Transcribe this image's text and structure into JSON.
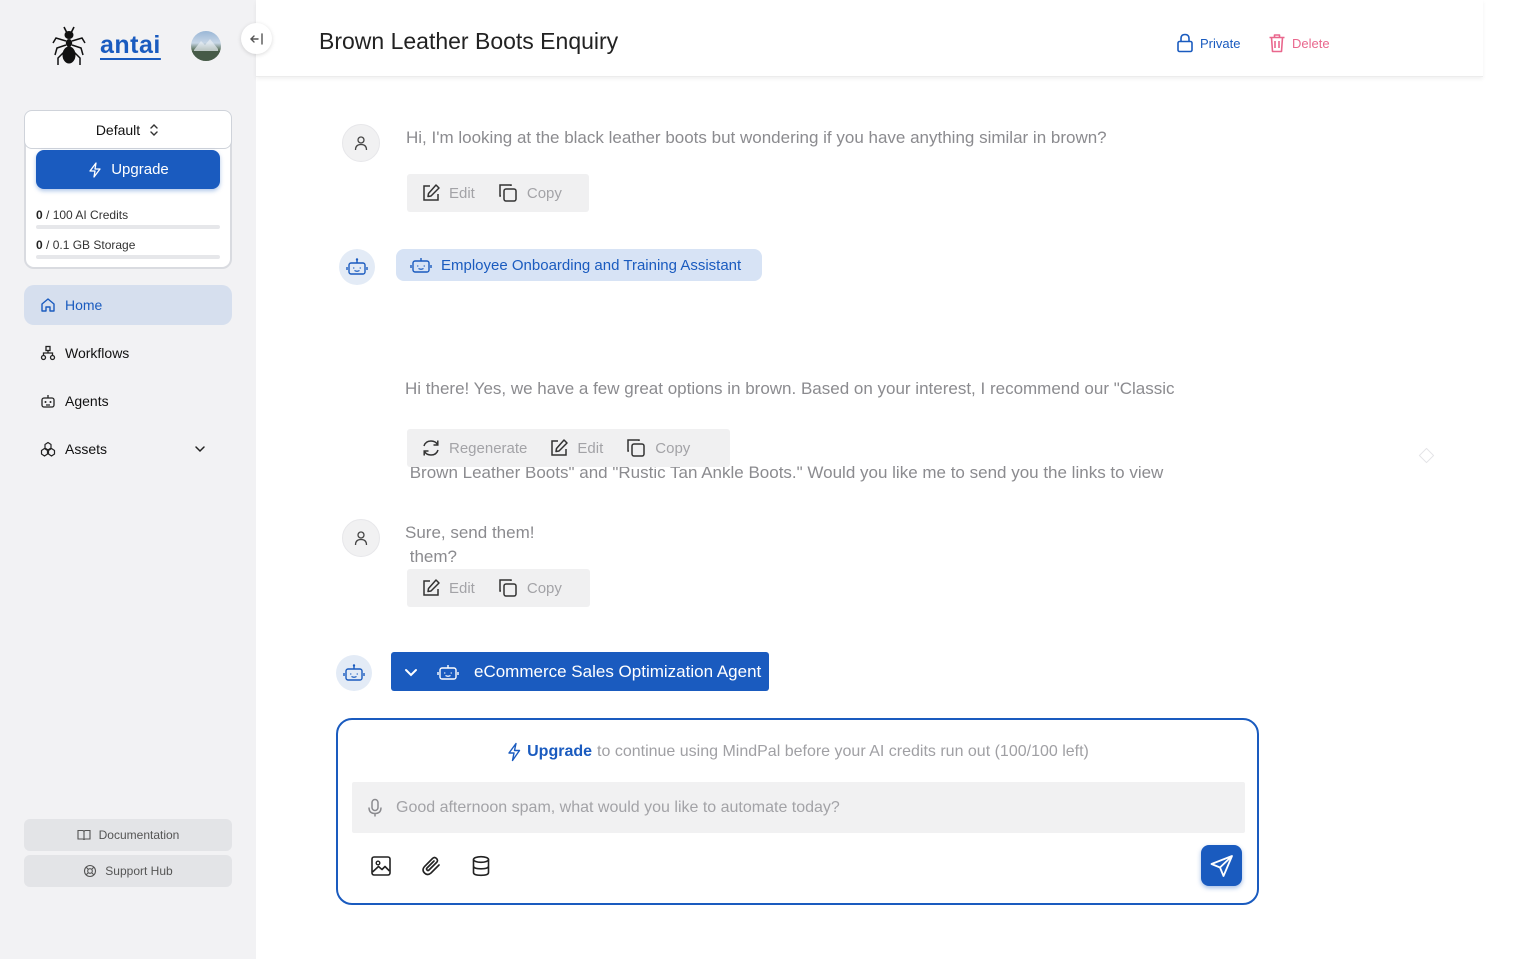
{
  "sidebar": {
    "brand": "antai",
    "workspace": {
      "label": "Default"
    },
    "upgrade_label": "Upgrade",
    "quotas": [
      {
        "used": "0",
        "rest": " / 100 AI Credits",
        "fraction": 0
      },
      {
        "used": "0",
        "rest": " / 0.1 GB Storage",
        "fraction": 0
      }
    ],
    "nav": [
      {
        "label": "Home",
        "icon": "home-icon",
        "active": true
      },
      {
        "label": "Workflows",
        "icon": "workflow-icon"
      },
      {
        "label": "Agents",
        "icon": "robot-icon"
      },
      {
        "label": "Assets",
        "icon": "assets-icon"
      }
    ],
    "footer": {
      "documentation": "Documentation",
      "support": "Support Hub"
    }
  },
  "header": {
    "title": "Brown Leather Boots Enquiry",
    "private_label": "Private",
    "delete_label": "Delete"
  },
  "chat": {
    "messages": [
      {
        "role": "user",
        "text": "Hi, I'm looking at the black leather boots but wondering if you have anything similar in brown?",
        "actions": [
          "Edit",
          "Copy"
        ]
      },
      {
        "role": "agent",
        "agent_name": "Employee Onboarding and Training Assistant",
        "lines": [
          "Hi there! Yes, we have a few great options in brown. Based on your interest, I recommend our \"Classic",
          " Brown Leather Boots\" and \"Rustic Tan Ankle Boots.\" Would you like me to send you the links to view",
          " them?"
        ],
        "actions": [
          "Regenerate",
          "Edit",
          "Copy"
        ]
      },
      {
        "role": "user",
        "text": "Sure, send them!",
        "actions": [
          "Edit",
          "Copy"
        ]
      }
    ],
    "selected_agent": "eCommerce Sales Optimization Agent"
  },
  "composer": {
    "upgrade_link": "Upgrade",
    "upgrade_text": "to continue using MindPal before your AI credits run out (100/100 left)",
    "placeholder": "Good afternoon spam, what would you like to automate today?",
    "value": ""
  },
  "colors": {
    "accent": "#1a5bbf",
    "delete": "#e9678d",
    "sidebar_bg": "#f2f2f4"
  }
}
